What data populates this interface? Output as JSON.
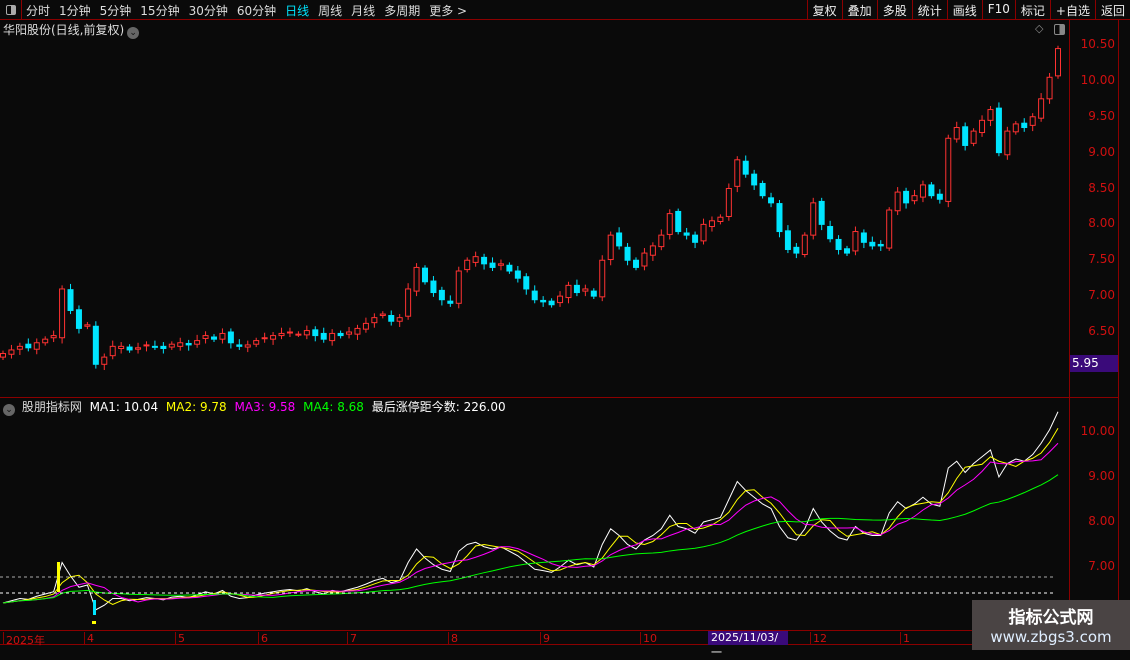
{
  "toolbar": {
    "periods": [
      "分时",
      "1分钟",
      "5分钟",
      "15分钟",
      "30分钟",
      "60分钟",
      "日线",
      "周线",
      "月线",
      "多周期",
      "更多 >"
    ],
    "active_period": "日线",
    "tools": [
      "复权",
      "叠加",
      "多股",
      "统计",
      "画线",
      "F10",
      "标记",
      "+自选",
      "返回"
    ]
  },
  "title": "华阳股份(日线,前复权)",
  "price_axis": [
    "10.50",
    "10.00",
    "9.50",
    "9.00",
    "8.50",
    "8.00",
    "7.50",
    "7.00",
    "6.50"
  ],
  "current_price_label": "5.95",
  "indicator": {
    "name": "股朋指标网",
    "ma1": "MA1: 10.04",
    "ma2": "MA2: 9.78",
    "ma3": "MA3: 9.58",
    "ma4": "MA4: 8.68",
    "extra": "最后涨停距今数: 226.00",
    "axis": [
      "10.00",
      "9.00",
      "8.00",
      "7.00"
    ],
    "colors": {
      "ma1": "#ffffff",
      "ma2": "#ffff00",
      "ma3": "#ff00ff",
      "ma4": "#00ff00"
    }
  },
  "date_axis": [
    "2025年",
    "4",
    "5",
    "6",
    "7",
    "8",
    "9",
    "10",
    "12",
    "1"
  ],
  "date_cursor": "2025/11/03/一",
  "watermark": {
    "line1": "指标公式网",
    "line2": "www.zbgs3.com"
  },
  "colors": {
    "up": "#ff3232",
    "down": "#00e5ff",
    "grid": "#8b0000",
    "axis_text": "#d01010"
  },
  "chart_data": {
    "type": "candlestick",
    "ylim": [
      5.95,
      10.6
    ],
    "closes": [
      6.2,
      6.25,
      6.3,
      6.28,
      6.35,
      6.4,
      6.45,
      7.1,
      6.8,
      6.55,
      6.6,
      6.05,
      6.15,
      6.3,
      6.3,
      6.25,
      6.28,
      6.32,
      6.3,
      6.27,
      6.33,
      6.35,
      6.32,
      6.38,
      6.45,
      6.4,
      6.48,
      6.35,
      6.3,
      6.32,
      6.38,
      6.42,
      6.45,
      6.48,
      6.5,
      6.47,
      6.52,
      6.45,
      6.4,
      6.48,
      6.45,
      6.5,
      6.55,
      6.62,
      6.7,
      6.75,
      6.65,
      6.7,
      7.1,
      7.4,
      7.2,
      7.05,
      6.95,
      6.9,
      7.35,
      7.5,
      7.55,
      7.45,
      7.4,
      7.45,
      7.35,
      7.25,
      7.1,
      6.95,
      6.92,
      6.88,
      7.0,
      7.15,
      7.05,
      7.1,
      7.0,
      7.5,
      7.85,
      7.7,
      7.5,
      7.4,
      7.6,
      7.7,
      7.85,
      8.15,
      7.9,
      7.85,
      7.75,
      8.0,
      8.05,
      8.1,
      8.5,
      8.9,
      8.7,
      8.55,
      8.4,
      8.3,
      7.9,
      7.65,
      7.6,
      7.85,
      8.3,
      8.0,
      7.8,
      7.65,
      7.6,
      7.9,
      7.75,
      7.7,
      7.7,
      8.2,
      8.45,
      8.3,
      8.4,
      8.55,
      8.4,
      8.35,
      9.2,
      9.35,
      9.1,
      9.3,
      9.45,
      9.6,
      9.0,
      9.3,
      9.4,
      9.35,
      9.5,
      9.75,
      10.05,
      10.45
    ]
  }
}
